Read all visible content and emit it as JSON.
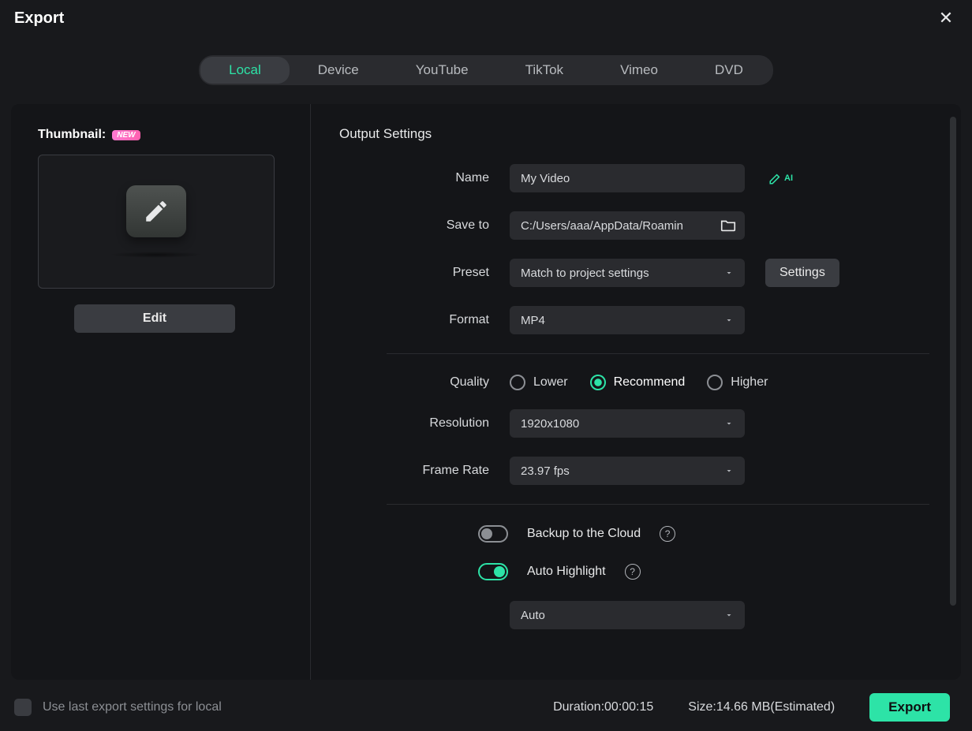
{
  "window": {
    "title": "Export"
  },
  "tabs": [
    "Local",
    "Device",
    "YouTube",
    "TikTok",
    "Vimeo",
    "DVD"
  ],
  "active_tab_index": 0,
  "thumbnail": {
    "label": "Thumbnail:",
    "new_badge": "NEW",
    "edit_button": "Edit"
  },
  "output": {
    "section_title": "Output Settings",
    "name_label": "Name",
    "name_value": "My Video",
    "ai_label": "AI",
    "saveto_label": "Save to",
    "saveto_value": "C:/Users/aaa/AppData/Roamin",
    "preset_label": "Preset",
    "preset_value": "Match to project settings",
    "settings_button": "Settings",
    "format_label": "Format",
    "format_value": "MP4",
    "quality_label": "Quality",
    "quality_options": {
      "lower": "Lower",
      "recommend": "Recommend",
      "higher": "Higher"
    },
    "quality_selected": "recommend",
    "resolution_label": "Resolution",
    "resolution_value": "1920x1080",
    "framerate_label": "Frame Rate",
    "framerate_value": "23.97 fps",
    "backup_label": "Backup to the Cloud",
    "backup_on": false,
    "autohighlight_label": "Auto Highlight",
    "autohighlight_on": true,
    "autohighlight_mode": "Auto"
  },
  "footer": {
    "use_last_label": "Use last export settings for local",
    "duration_label": "Duration:",
    "duration_value": "00:00:15",
    "size_label": "Size:",
    "size_value": "14.66 MB",
    "size_suffix": "(Estimated)",
    "export_button": "Export"
  },
  "colors": {
    "accent": "#2de3a7"
  }
}
